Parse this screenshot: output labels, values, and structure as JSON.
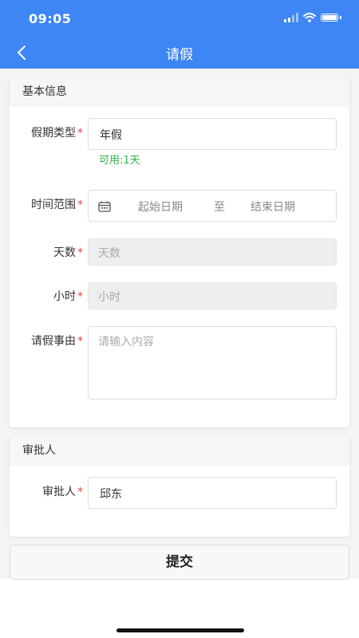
{
  "status_bar": {
    "time": "09:05"
  },
  "nav": {
    "title": "请假"
  },
  "basic_section": {
    "header": "基本信息",
    "leave_type": {
      "label": "假期类型",
      "value": "年假",
      "hint": "可用:1天"
    },
    "time_range": {
      "label": "时间范围",
      "start_placeholder": "起始日期",
      "separator": "至",
      "end_placeholder": "结束日期"
    },
    "days": {
      "label": "天数",
      "placeholder": "天数"
    },
    "hours": {
      "label": "小时",
      "placeholder": "小时"
    },
    "reason": {
      "label": "请假事由",
      "placeholder": "请输入内容"
    },
    "required_mark": "*"
  },
  "approver_section": {
    "header": "审批人",
    "approver": {
      "label": "审批人",
      "value": "邱东"
    }
  },
  "submit": {
    "label": "提交"
  },
  "colors": {
    "primary": "#3e86f3",
    "required": "#e64340",
    "hint": "#33b249"
  }
}
